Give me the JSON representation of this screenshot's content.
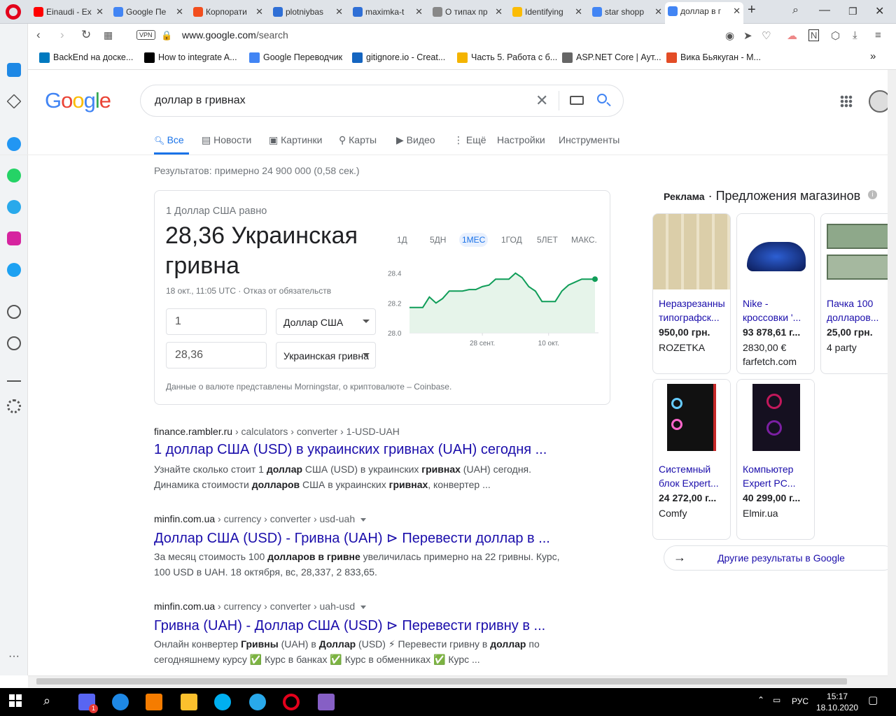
{
  "browser": {
    "tabs": [
      {
        "title": "Einaudi - Ex",
        "color": "#ff0000"
      },
      {
        "title": "Google Пе",
        "color": "#4285f4"
      },
      {
        "title": "Корпорати",
        "color": "#f24e1e"
      },
      {
        "title": "plotniybas",
        "color": "#2f6fd6"
      },
      {
        "title": "maximka-t",
        "color": "#2f6fd6"
      },
      {
        "title": "О типах пр",
        "color": "#888888"
      },
      {
        "title": "Identifying",
        "color": "#fbbc05"
      },
      {
        "title": "star shopp",
        "color": "#4285f4"
      },
      {
        "title": "доллар в г",
        "color": "#4285f4"
      }
    ],
    "vpn_label": "VPN",
    "url_domain": "www.google.com",
    "url_path": "/search",
    "bookmarks": [
      {
        "label": "BackEnd на доске...",
        "color": "#0079bf"
      },
      {
        "label": "How to integrate A...",
        "color": "#000000"
      },
      {
        "label": "Google Переводчик",
        "color": "#4285f4"
      },
      {
        "label": "gitignore.io - Creat...",
        "color": "#1565c0"
      },
      {
        "label": "Часть 5. Работа с б...",
        "color": "#f4b400"
      },
      {
        "label": "ASP.NET Core | Аут...",
        "color": "#666666"
      },
      {
        "label": "Вика Бьякуган - М...",
        "color": "#e34c26"
      }
    ],
    "bookmarks_more": "»"
  },
  "google": {
    "logo": [
      "G",
      "o",
      "o",
      "g",
      "l",
      "e"
    ],
    "logo_colors": [
      "#4285f4",
      "#ea4335",
      "#fbbc05",
      "#4285f4",
      "#34a853",
      "#ea4335"
    ],
    "query": "доллар в гривнах",
    "clear": "✕",
    "nav": [
      "Все",
      "Новости",
      "Картинки",
      "Карты",
      "Видео",
      "Ещё",
      "Настройки",
      "Инструменты"
    ],
    "stats": "Результатов: примерно 24 900 000 (0,58 сек.)"
  },
  "converter": {
    "equals_label": "1 Доллар США равно",
    "result": "28,36 Украинская гривна",
    "date_line": "18 окт., 11:05 UTC · Отказ от обязательств",
    "amount_from": "1",
    "currency_from": "Доллар США",
    "amount_to": "28,36",
    "currency_to": "Украинская гривна",
    "ranges": [
      "1Д",
      "5ДН",
      "1МЕС",
      "1ГОД",
      "5ЛЕТ",
      "МАКС."
    ],
    "source_note": "Данные о валюте представлены Morningstar, о криптовалюте – Coinbase."
  },
  "chart_data": {
    "type": "area",
    "y_ticks": [
      "28.4",
      "28.2",
      "28.0"
    ],
    "ylim": [
      28.0,
      28.45
    ],
    "x_ticks": [
      "28 сент.",
      "10 окт."
    ],
    "values": [
      28.17,
      28.17,
      28.17,
      28.24,
      28.2,
      28.23,
      28.28,
      28.28,
      28.28,
      28.29,
      28.29,
      28.31,
      28.32,
      28.36,
      28.36,
      28.36,
      28.4,
      28.37,
      28.31,
      28.28,
      28.21,
      28.21,
      28.21,
      28.28,
      28.32,
      28.34,
      28.36,
      28.36,
      28.36
    ],
    "color": "#0f9d58",
    "fill": "#e6f4ea"
  },
  "results": [
    {
      "domain": "finance.rambler.ru",
      "path": " › calculators › converter › 1-USD-UAH",
      "caret": false,
      "title": "1 доллар США (USD) в украинских гривнах (UAH) сегодня ...",
      "snippet": "Узнайте сколько стоит 1 <b>доллар</b> США (USD) в украинских <b>гривнах</b> (UAH) сегодня. Динамика стоимости <b>долларов</b> США в украинских <b>гривнах</b>, конвертер ..."
    },
    {
      "domain": "minfin.com.ua",
      "path": " › currency › converter › usd-uah",
      "caret": true,
      "title": "Доллар США (USD) - Гривна (UAH) ⊳ Перевести доллар в ...",
      "snippet": "За месяц стоимость 100 <b>долларов в гривне</b> увеличилась примерно на 22 гривны. Курс, 100 USD в UAH. 18 октября, вс, 28,337, 2 833,65."
    },
    {
      "domain": "minfin.com.ua",
      "path": " › currency › converter › uah-usd",
      "caret": true,
      "title": "Гривна (UAH) - Доллар США (USD) ⊳ Перевести гривну в ...",
      "snippet": "Онлайн конвертер <b>Гривны</b> (UAH) в <b>Доллар</b> (USD) ⚡ Перевести гривну в <b>доллар</b> по сегодняшнему курсу ✅ Курс в банках ✅ Курс в обменниках ✅ Курс ..."
    }
  ],
  "shopping": {
    "ad_label": "Реклама",
    "heading": "Предложения магазинов",
    "info": "i",
    "products": [
      {
        "name": "Неразрезанны типографск...",
        "price": "950,00 грн.",
        "store": "ROZETKA",
        "img": "money-sheet"
      },
      {
        "name": "Nike - кроссовки '...",
        "price": "93 878,61 г...",
        "store": "2830,00 € farfetch.com",
        "img": "sneaker"
      },
      {
        "name": "Пачка 100 долларов...",
        "price": "25,00 грн.",
        "store": "4 party",
        "img": "dollars"
      },
      {
        "name": "Системный блок Expert...",
        "price": "24 272,00 г...",
        "store": "Comfy",
        "img": "pc-red"
      },
      {
        "name": "Компьютер Expert PC...",
        "price": "40 299,00 г...",
        "store": "Elmir.ua",
        "img": "pc-purple"
      }
    ],
    "more": "Другие результаты в Google"
  },
  "status_url": "",
  "taskbar": {
    "lang": "РУС",
    "time": "15:17",
    "date": "18.10.2020",
    "badge": "1"
  }
}
